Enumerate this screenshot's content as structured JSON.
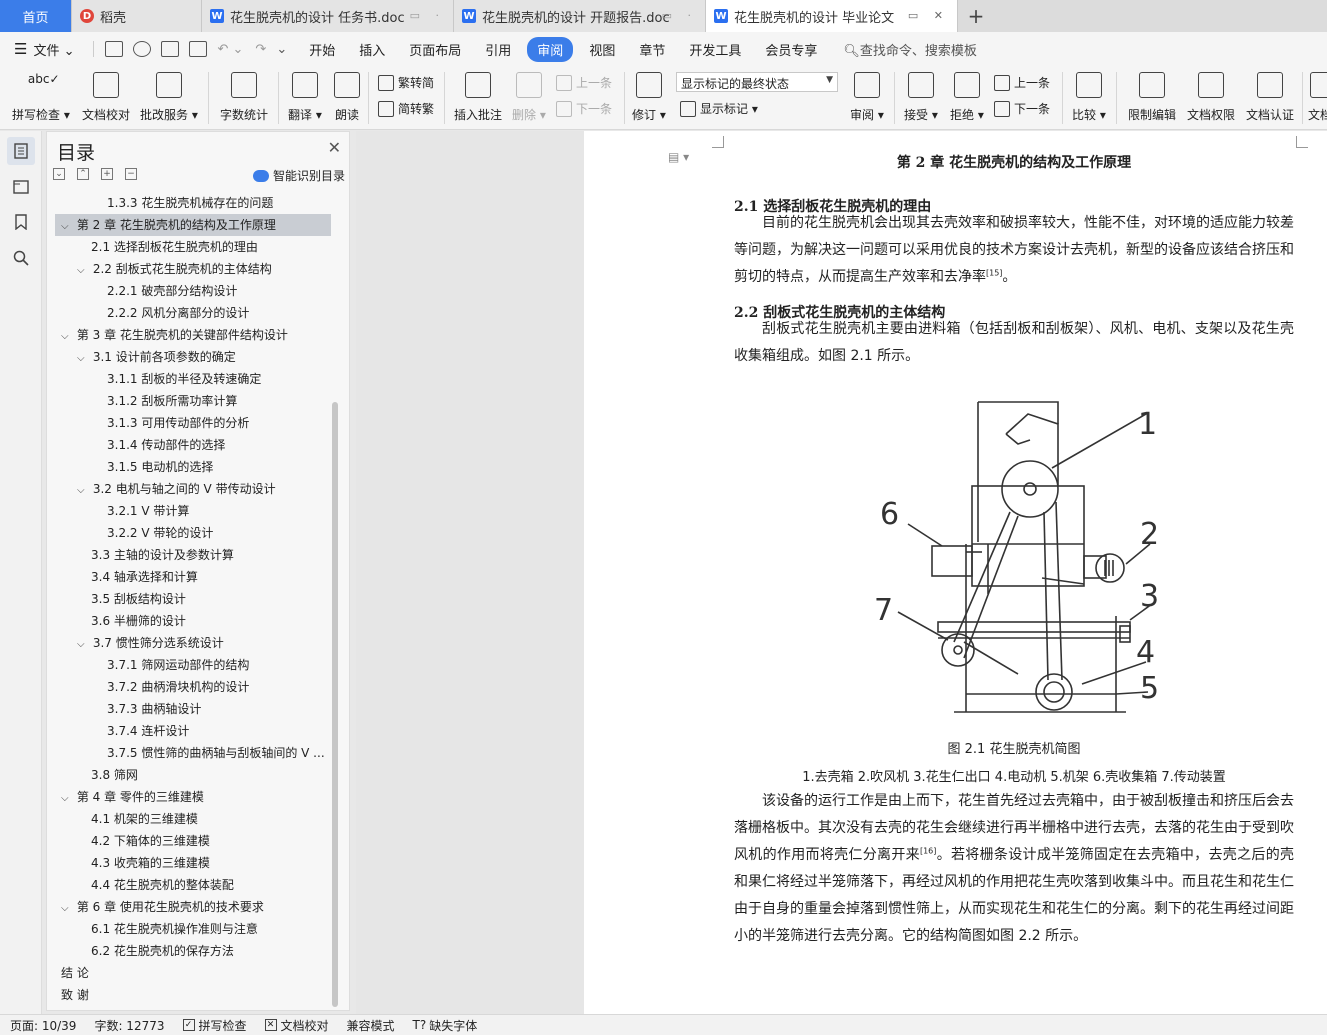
{
  "tabs": {
    "home": "首页",
    "t1": "稻壳",
    "t2": "花生脱壳机的设计 任务书.doc",
    "t3": "花生脱壳机的设计 开题报告.doc",
    "t4": "花生脱壳机的设计 毕业论文"
  },
  "menu": {
    "file": "文件",
    "items": [
      "开始",
      "插入",
      "页面布局",
      "引用",
      "审阅",
      "视图",
      "章节",
      "开发工具",
      "会员专享"
    ],
    "search": "查找命令、搜索模板"
  },
  "ribbon": {
    "spell": "拼写检查",
    "doccheck": "文档校对",
    "batch": "批改服务",
    "wordcount": "字数统计",
    "translate": "翻译",
    "read": "朗读",
    "trad": "繁转简",
    "simp": "简转繁",
    "insert_comment": "插入批注",
    "delete": "删除",
    "prev": "上一条",
    "next": "下一条",
    "revise": "修订",
    "markup_state": "显示标记的最终状态",
    "show_markup": "显示标记",
    "review": "审阅",
    "accept": "接受",
    "reject": "拒绝",
    "prev2": "上一条",
    "next2": "下一条",
    "compare": "比较",
    "restrict": "限制编辑",
    "perm": "文档权限",
    "cert": "文档认证",
    "more": "文档"
  },
  "toc": {
    "title": "目录",
    "ai_label": "智能识别目录",
    "items": [
      {
        "text": "1.3.3 花生脱壳机械存在的问题",
        "level": 3,
        "chev": ""
      },
      {
        "text": "第 2 章 花生脱壳机的结构及工作原理",
        "level": 1,
        "chev": "⌄"
      },
      {
        "text": "2.1 选择刮板花生脱壳机的理由",
        "level": 2,
        "chev": ""
      },
      {
        "text": "2.2 刮板式花生脱壳机的主体结构",
        "level": 2,
        "chev": "⌄"
      },
      {
        "text": "2.2.1 破壳部分结构设计",
        "level": 3,
        "chev": ""
      },
      {
        "text": "2.2.2 风机分离部分的设计",
        "level": 3,
        "chev": ""
      },
      {
        "text": "第 3 章 花生脱壳机的关键部件结构设计",
        "level": 1,
        "chev": "⌄"
      },
      {
        "text": "3.1 设计前各项参数的确定",
        "level": 2,
        "chev": "⌄"
      },
      {
        "text": "3.1.1 刮板的半径及转速确定",
        "level": 3,
        "chev": ""
      },
      {
        "text": "3.1.2 刮板所需功率计算",
        "level": 3,
        "chev": ""
      },
      {
        "text": "3.1.3 可用传动部件的分析",
        "level": 3,
        "chev": ""
      },
      {
        "text": "3.1.4 传动部件的选择",
        "level": 3,
        "chev": ""
      },
      {
        "text": "3.1.5 电动机的选择",
        "level": 3,
        "chev": ""
      },
      {
        "text": "3.2 电机与轴之间的 V 带传动设计",
        "level": 2,
        "chev": "⌄"
      },
      {
        "text": "3.2.1 V 带计算",
        "level": 3,
        "chev": ""
      },
      {
        "text": "3.2.2 V 带轮的设计",
        "level": 3,
        "chev": ""
      },
      {
        "text": "3.3 主轴的设计及参数计算",
        "level": 2,
        "chev": ""
      },
      {
        "text": "3.4 轴承选择和计算",
        "level": 2,
        "chev": ""
      },
      {
        "text": "3.5 刮板结构设计",
        "level": 2,
        "chev": ""
      },
      {
        "text": "3.6 半栅筛的设计",
        "level": 2,
        "chev": ""
      },
      {
        "text": "3.7 惯性筛分选系统设计",
        "level": 2,
        "chev": "⌄"
      },
      {
        "text": "3.7.1 筛网运动部件的结构",
        "level": 3,
        "chev": ""
      },
      {
        "text": "3.7.2 曲柄滑块机构的设计",
        "level": 3,
        "chev": ""
      },
      {
        "text": "3.7.3 曲柄轴设计",
        "level": 3,
        "chev": ""
      },
      {
        "text": "3.7.4 连杆设计",
        "level": 3,
        "chev": ""
      },
      {
        "text": "3.7.5 惯性筛的曲柄轴与刮板轴间的 V ...",
        "level": 3,
        "chev": ""
      },
      {
        "text": "3.8 筛网",
        "level": 2,
        "chev": ""
      },
      {
        "text": "第 4 章 零件的三维建模",
        "level": 1,
        "chev": "⌄"
      },
      {
        "text": "4.1 机架的三维建模",
        "level": 2,
        "chev": ""
      },
      {
        "text": "4.2 下箱体的三维建模",
        "level": 2,
        "chev": ""
      },
      {
        "text": "4.3 收壳箱的三维建模",
        "level": 2,
        "chev": ""
      },
      {
        "text": "4.4 花生脱壳机的整体装配",
        "level": 2,
        "chev": ""
      },
      {
        "text": "第 6 章 使用花生脱壳机的技术要求",
        "level": 1,
        "chev": "⌄"
      },
      {
        "text": "6.1 花生脱壳机操作准则与注意",
        "level": 2,
        "chev": ""
      },
      {
        "text": "6.2 花生脱壳机的保存方法",
        "level": 2,
        "chev": ""
      },
      {
        "text": "结 论",
        "level": 1,
        "chev": ""
      },
      {
        "text": "致 谢",
        "level": 1,
        "chev": ""
      }
    ]
  },
  "doc": {
    "chapter": "第 2 章 花生脱壳机的结构及工作原理",
    "sec1": "2.1 选择刮板花生脱壳机的理由",
    "p1": "目前的花生脱壳机会出现其去壳效率和破损率较大，性能不佳，对环境的适应能力较差等问题，为解决这一问题可以采用优良的技术方案设计去壳机，新型的设备应该结合挤压和剪切的特点，从而提高生产效率和去净率",
    "p1_ref": "[15]",
    "p1_end": "。",
    "sec2": "2.2 刮板式花生脱壳机的主体结构",
    "p2": "刮板式花生脱壳机主要由进料箱（包括刮板和刮板架）、风机、电机、支架以及花生壳收集箱组成。如图 2.1 所示。",
    "fig_caption": "图 2.1 花生脱壳机简图",
    "fig_legend": "1.去壳箱 2.吹风机 3.花生仁出口 4.电动机 5.机架 6.壳收集箱 7.传动装置",
    "fig_labels": [
      "1",
      "2",
      "3",
      "4",
      "5",
      "6",
      "7"
    ],
    "p3a": "该设备的运行工作是由上而下，花生首先经过去壳箱中，由于被刮板撞击和挤压后会去落栅格板中。其次没有去壳的花生会继续进行再半栅格中进行去壳，去落的花生由于受到吹风机的作用而将壳仁分离开来",
    "p3_ref": "[16]",
    "p3b": "。若将栅条设计成半笼筛固定在去壳箱中，去壳之后的壳和果仁将经过半笼筛落下，再经过风机的作用把花生壳吹落到收集斗中。而且花生和花生仁由于自身的重量会掉落到惯性筛上，从而实现花生和花生仁的分离。剩下的花生再经过间距小的半笼筛进行去壳分离。它的结构简图如图 2.2 所示。"
  },
  "status": {
    "page": "页面: 10/39",
    "words": "字数: 12773",
    "spell": "拼写检查",
    "doccheck": "文档校对",
    "compat": "兼容模式",
    "missing_font": "缺失字体"
  }
}
